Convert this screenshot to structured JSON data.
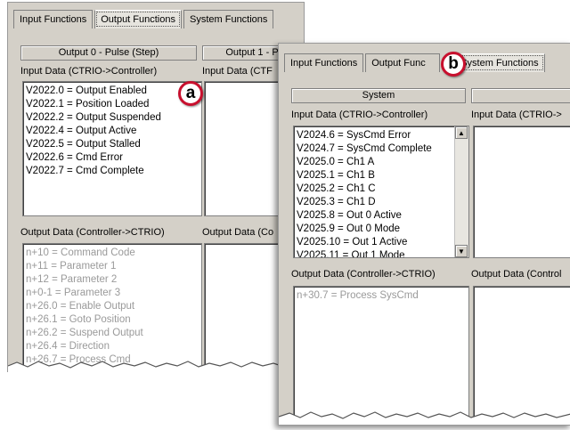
{
  "panel_a": {
    "tabs": [
      "Input Functions",
      "Output Functions",
      "System Functions"
    ],
    "columns": [
      "Output 0 - Pulse (Step)",
      "Output 1 - P"
    ],
    "input_label": "Input Data (CTRIO->Controller)",
    "input_label_2": "Input Data (CTF",
    "input_items": [
      "V2022.0 = Output Enabled",
      "V2022.1 = Position Loaded",
      "V2022.2 = Output Suspended",
      "V2022.4 = Output Active",
      "V2022.5 = Output Stalled",
      "V2022.6 = Cmd Error",
      "V2022.7 = Cmd Complete"
    ],
    "output_label": "Output Data (Controller->CTRIO)",
    "output_label_2": "Output Data (Co",
    "output_items": [
      "n+10 = Command Code",
      "n+11 = Parameter 1",
      "n+12 = Parameter 2",
      "n+0-1 = Parameter 3",
      "n+26.0 = Enable Output",
      "n+26.1 = Goto Position",
      "n+26.2 = Suspend Output",
      "n+26.4 = Direction",
      "n+26.7 = Process Cmd"
    ]
  },
  "panel_b": {
    "tabs": [
      "Input Functions",
      "Output Func",
      "System Functions"
    ],
    "columns": [
      "System",
      ""
    ],
    "input_label": "Input Data (CTRIO->Controller)",
    "input_label_2": "Input Data (CTRIO->",
    "input_items": [
      "V2024.6 = SysCmd Error",
      "V2024.7 = SysCmd Complete",
      "V2025.0 = Ch1 A",
      "V2025.1 = Ch1 B",
      "V2025.2 = Ch1 C",
      "V2025.3 = Ch1 D",
      "V2025.8 = Out 0 Active",
      "V2025.9 = Out 0 Mode",
      "V2025.10 = Out 1 Active",
      "V2025.11 = Out 1 Mode"
    ],
    "output_label": "Output Data (Controller->CTRIO)",
    "output_label_2": "Output Data (Control",
    "output_items": [
      "n+30.7 = Process SysCmd"
    ]
  },
  "callouts": {
    "a": "a",
    "b": "b"
  },
  "colors": {
    "callout_ring": "#c8102e",
    "dialog_bg": "#d4d0c8"
  }
}
